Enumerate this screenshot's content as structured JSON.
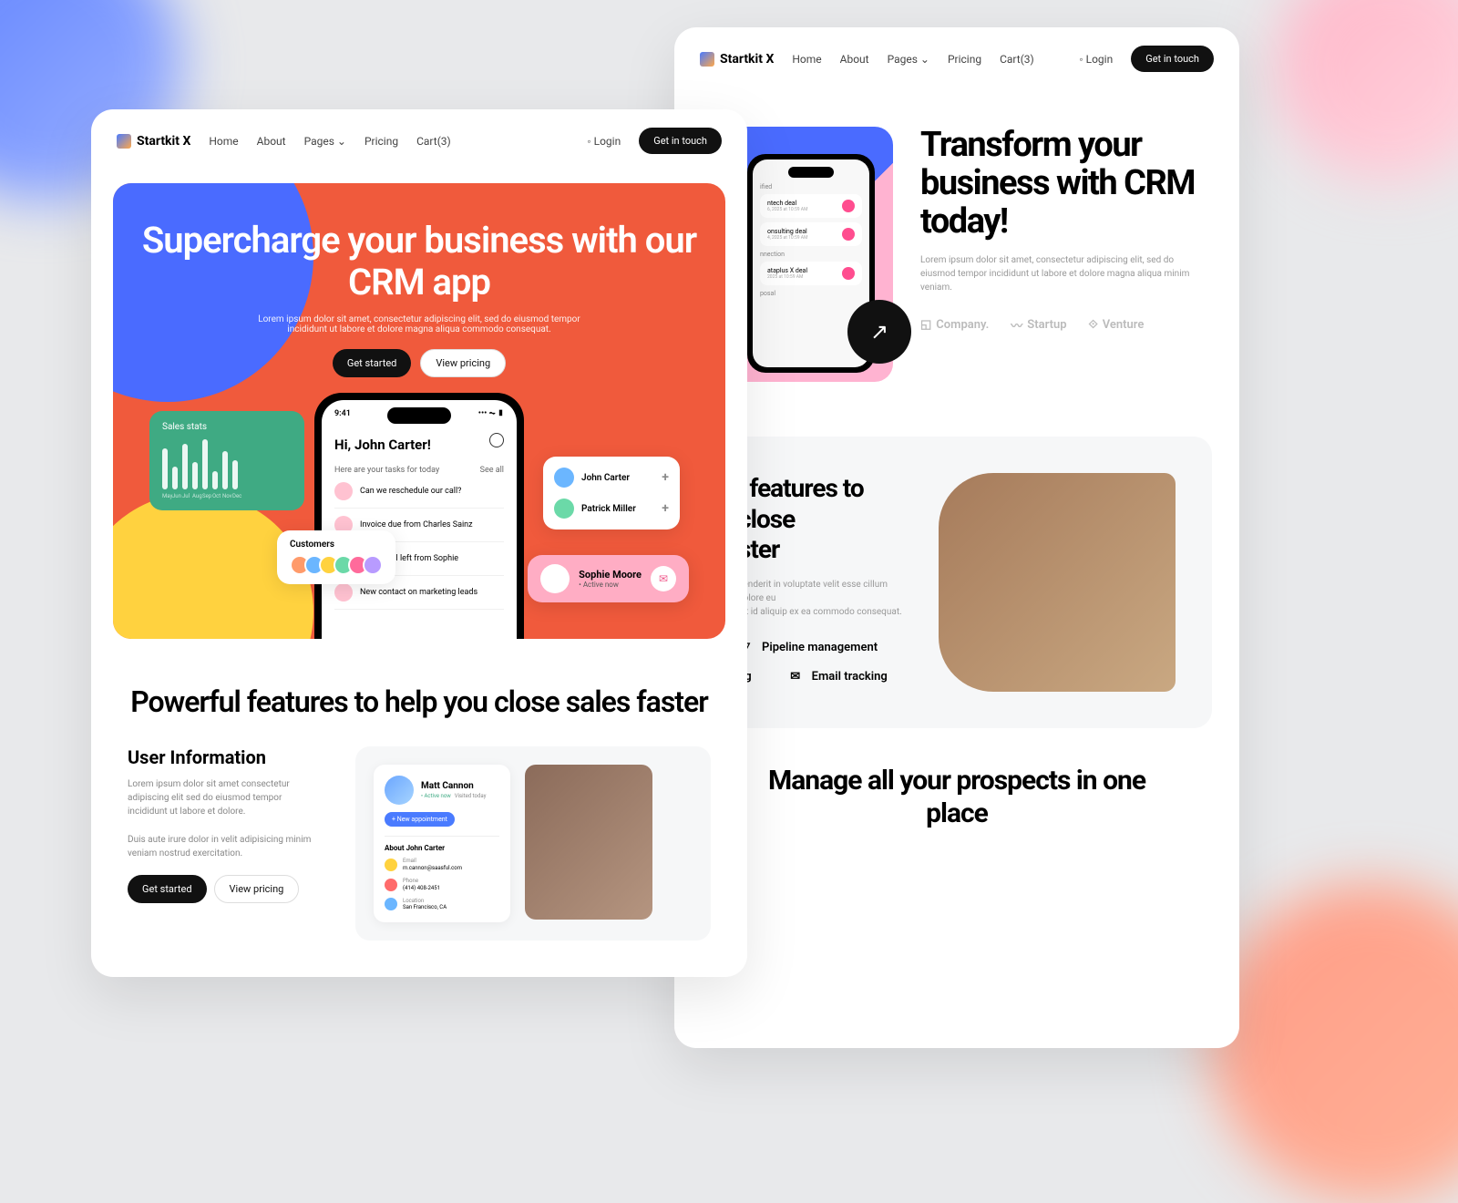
{
  "brand": "Startkit X",
  "nav": {
    "home": "Home",
    "about": "About",
    "pages": "Pages",
    "pricing": "Pricing",
    "cart": "Cart(3)",
    "login": "Login",
    "cta": "Get in touch"
  },
  "hero": {
    "title": "Supercharge your business with our CRM app",
    "subtitle": "Lorem ipsum dolor sit amet, consectetur adipiscing elit, sed do eiusmod tempor incididunt ut labore et dolore magna aliqua commodo consequat.",
    "primary": "Get started",
    "secondary": "View pricing"
  },
  "phone": {
    "time": "9:41",
    "greeting": "Hi, John Carter!",
    "tasks_header": "Here are your tasks for today",
    "see_all": "See all",
    "tasks": [
      "Can we reschedule our call?",
      "Invoice due from Charles Sainz",
      "Voice mail left from Sophie",
      "New contact on marketing leads"
    ]
  },
  "stats": {
    "title": "Sales stats",
    "months": [
      "May",
      "Jun",
      "Jul",
      "Aug",
      "Sep",
      "Oct",
      "Nov",
      "Dec"
    ],
    "heights": [
      45,
      25,
      50,
      30,
      55,
      20,
      42,
      32
    ]
  },
  "customers": {
    "title": "Customers",
    "colors": [
      "#ff9b6b",
      "#6bb6ff",
      "#ffd23f",
      "#6bd9a8",
      "#ff6b9b",
      "#b89bff"
    ]
  },
  "contacts": [
    {
      "name": "John Carter",
      "color": "#6bb6ff"
    },
    {
      "name": "Patrick Miller",
      "color": "#6bd9a8"
    }
  ],
  "sophie": {
    "name": "Sophie Moore",
    "status": "• Active now"
  },
  "section2": {
    "title": "Powerful features to help you close sales faster"
  },
  "userinfo": {
    "title": "User Information",
    "body": "Lorem ipsum dolor sit amet consectetur adipiscing elit sed do eiusmod tempor incididunt ut labore et dolore.",
    "body2": "Duis aute irure dolor in velit adipisicing minim veniam nostrud exercitation.",
    "primary": "Get started",
    "secondary": "View pricing"
  },
  "profile": {
    "name": "Matt Cannon",
    "tag1": "• Active now",
    "tag2": "Visited today",
    "btn": "+  New appointment",
    "about": "About John Carter",
    "email": {
      "label": "Email",
      "value": "m.cannon@saasful.com"
    },
    "phone": {
      "label": "Phone",
      "value": "(414) 408-2451"
    },
    "location": {
      "label": "Location",
      "value": "San Francisco, CA"
    }
  },
  "transform": {
    "title": "Transform your business with CRM today!",
    "body": "Lorem ipsum dolor sit amet, consectetur adipiscing elit, sed do eiusmod tempor incididunt ut labore et dolore magna aliqua minim veniam.",
    "logos": [
      "Company.",
      "Startup",
      "Venture"
    ],
    "deals": [
      {
        "name": "ntech deal",
        "date": "6, 2025 at 10:59 AM",
        "color": "#ff4d8f"
      },
      {
        "name": "onsulting deal",
        "date": "4, 2025 at 10:59 AM",
        "color": "#ff4d8f"
      },
      {
        "name": "ataplus X deal",
        "date": "2025 at 10:59 AM",
        "color": "#ff4d8f"
      }
    ],
    "sections": [
      "ified",
      "nnection",
      "posal"
    ]
  },
  "features": {
    "title": "l features to\n close\nster",
    "body": "henderit in voluptate velit esse cillum dolore eu\nint id aliquip ex ea commodo consequat.",
    "items": [
      {
        "icon": "⚗",
        "label": "Pipeline management"
      },
      {
        "icon": "✉",
        "label": "Email tracking"
      }
    ],
    "other_label": "ng"
  },
  "manage": {
    "title": "Manage all your prospects in one place"
  }
}
